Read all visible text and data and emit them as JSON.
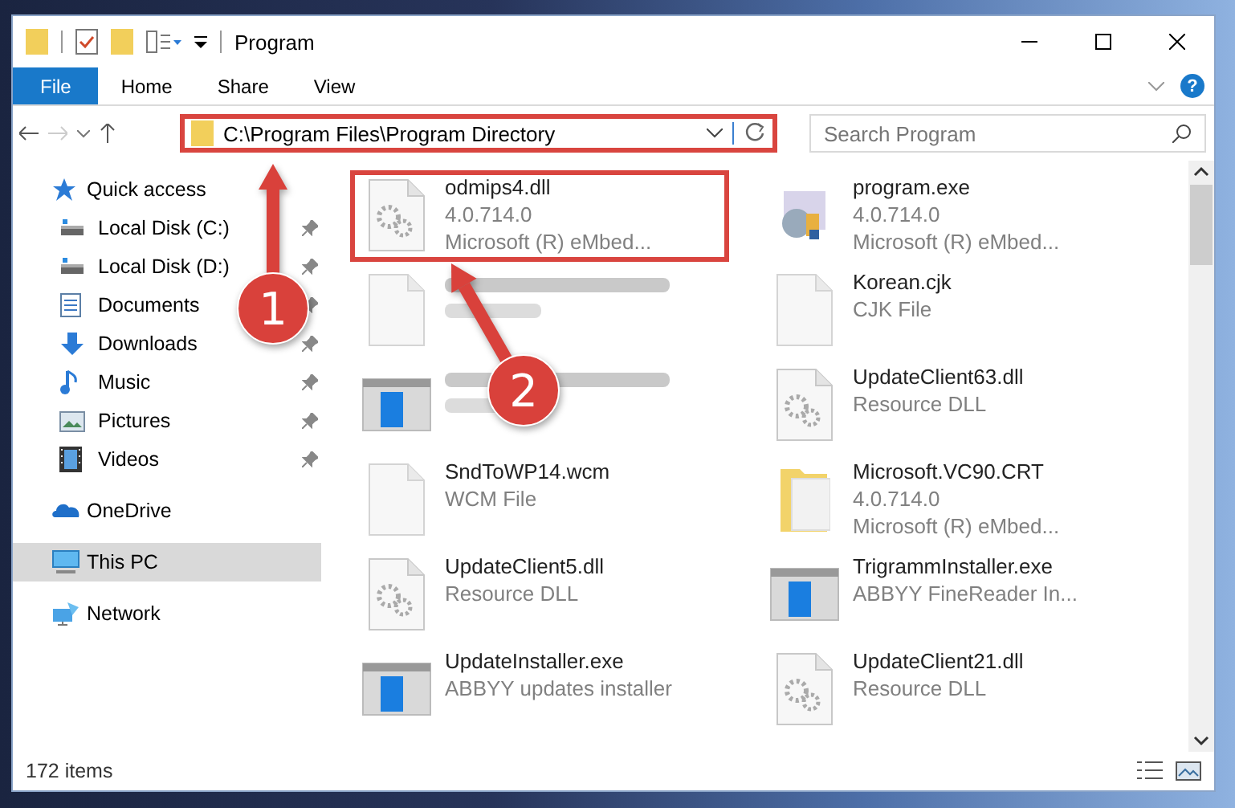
{
  "window": {
    "title": "Program"
  },
  "ribbon": {
    "tabs": [
      {
        "label": "File",
        "kind": "file",
        "selected": false
      },
      {
        "label": "Home",
        "kind": "tab",
        "selected": false
      },
      {
        "label": "Share",
        "kind": "tab",
        "selected": false
      },
      {
        "label": "View",
        "kind": "tab",
        "selected": false
      }
    ],
    "help": "?"
  },
  "address_bar": {
    "path": "C:\\Program Files\\Program Directory",
    "highlighted": true
  },
  "search": {
    "placeholder": "Search Program"
  },
  "navigation": [
    {
      "label": "Quick access",
      "kind": "star",
      "selected": false,
      "children": [
        {
          "label": "Local Disk (C:)",
          "kind": "drive",
          "pinned": true,
          "selected": false
        },
        {
          "label": "Local Disk (D:)",
          "kind": "drive",
          "pinned": true,
          "selected": false
        },
        {
          "label": "Documents",
          "kind": "documents",
          "pinned": true,
          "selected": false
        },
        {
          "label": "Downloads",
          "kind": "downloads",
          "pinned": true,
          "selected": false
        },
        {
          "label": "Music",
          "kind": "music",
          "pinned": true,
          "selected": false
        },
        {
          "label": "Pictures",
          "kind": "pictures",
          "pinned": true,
          "selected": false
        },
        {
          "label": "Videos",
          "kind": "videos",
          "pinned": true,
          "selected": false
        }
      ]
    },
    {
      "label": "OneDrive",
      "kind": "cloud",
      "selected": false
    },
    {
      "label": "This PC",
      "kind": "pc",
      "selected": true
    },
    {
      "label": "Network",
      "kind": "network",
      "selected": false
    }
  ],
  "files": [
    {
      "name": "odmips4.dll",
      "details": [
        "4.0.714.0",
        "Microsoft (R) eMbed..."
      ],
      "kind": "dll",
      "highlighted": true,
      "blurred": false
    },
    {
      "name": "program.exe",
      "details": [
        "4.0.714.0",
        "Microsoft (R) eMbed..."
      ],
      "kind": "exe",
      "highlighted": false,
      "blurred": false
    },
    {
      "kind": "blank",
      "highlighted": false,
      "blurred": true
    },
    {
      "name": "Korean.cjk",
      "details": [
        "CJK File"
      ],
      "kind": "blank",
      "highlighted": false,
      "blurred": false
    },
    {
      "kind": "app",
      "highlighted": false,
      "blurred": true
    },
    {
      "name": "UpdateClient63.dll",
      "details": [
        "Resource DLL"
      ],
      "kind": "dll",
      "highlighted": false,
      "blurred": false
    },
    {
      "name": "SndToWP14.wcm",
      "details": [
        "WCM File"
      ],
      "kind": "blank",
      "highlighted": false,
      "blurred": false
    },
    {
      "name": "Microsoft.VC90.CRT",
      "details": [
        "4.0.714.0",
        "Microsoft (R) eMbed..."
      ],
      "kind": "folder",
      "highlighted": false,
      "blurred": false
    },
    {
      "name": "UpdateClient5.dll",
      "details": [
        "Resource DLL"
      ],
      "kind": "dll",
      "highlighted": false,
      "blurred": false
    },
    {
      "name": "TrigrammInstaller.exe",
      "details": [
        "ABBYY FineReader In..."
      ],
      "kind": "app",
      "highlighted": false,
      "blurred": false
    },
    {
      "name": "UpdateInstaller.exe",
      "details": [
        "ABBYY updates installer"
      ],
      "kind": "app",
      "highlighted": false,
      "blurred": false
    },
    {
      "name": "UpdateClient21.dll",
      "details": [
        "Resource DLL"
      ],
      "kind": "dll",
      "highlighted": false,
      "blurred": false
    }
  ],
  "status_bar": {
    "item_count": "172 items"
  },
  "annotations": [
    {
      "number": "1"
    },
    {
      "number": "2"
    }
  ]
}
